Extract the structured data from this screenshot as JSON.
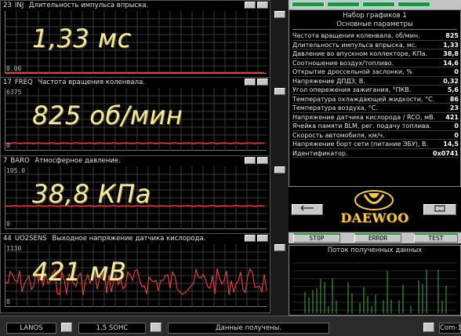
{
  "panels": [
    {
      "code": "23",
      "name": "INJ",
      "desc": "Длительность импульса впрыска.",
      "ymax": "",
      "ymin": "0.00",
      "big": "1,33 мс",
      "trace": "#e23b3b",
      "trace_level": 0.02
    },
    {
      "code": "17",
      "name": "FREQ",
      "desc": "Частота вращения коленвала.",
      "ymax": "6375",
      "ymin": "0",
      "big": "825 об/мин",
      "trace": "#e23b3b",
      "trace_level": 0.12
    },
    {
      "code": "7",
      "name": "BARO",
      "desc": "Атмосферное давление.",
      "ymax": "105.0",
      "ymin": "0",
      "big": "38,8 КПа",
      "trace": "#e23b3b",
      "trace_level": 0.37
    },
    {
      "code": "44",
      "name": "UO2SENS",
      "desc": "Выходное напряжение датчика кислорода.",
      "ymax": "1130",
      "ymin": "0",
      "big": "421 мВ",
      "trace": "#e23b3b",
      "trace_level": 0.4
    }
  ],
  "params": {
    "title": "Набор графиков 1",
    "subtitle": "Основные параметры",
    "rows": [
      {
        "label": "Частота вращения коленвала, об/мин.",
        "value": "825"
      },
      {
        "label": "Длительность импульса впрыска, мс.",
        "value": "1,33"
      },
      {
        "label": "Давление во впускном коллекторе, КПа.",
        "value": "38,8"
      },
      {
        "label": "Соотношение воздух/топливо.",
        "value": "14,6"
      },
      {
        "label": "Открытие дроссельной заслонки, %",
        "value": "0"
      },
      {
        "label": "Напряжение ДПДЗ, В.",
        "value": "0,32"
      },
      {
        "label": "Угол опережения зажигания, °ПКВ.",
        "value": "5,6"
      },
      {
        "label": "Температура охлаждающей жидкости, °С.",
        "value": "86"
      },
      {
        "label": "Температура воздуха, °С.",
        "value": "23"
      },
      {
        "label": "Напряжение датчика кислорода / RCO, мВ.",
        "value": "421"
      },
      {
        "label": "Ячейка памяти BLM, рег. подачу топлива.",
        "value": "0"
      },
      {
        "label": "Скорость автомобиля, км/ч.",
        "value": "0"
      },
      {
        "label": "Напряжение борт сети (питание ЭБУ), В.",
        "value": "14,5"
      },
      {
        "label": "Идентификатор.",
        "value": "0x0741"
      }
    ]
  },
  "logo": {
    "brand": "DAEWOO",
    "color": "#f2c74a"
  },
  "controls": {
    "stop": "STOP",
    "error": "ERROR",
    "test": "TEST"
  },
  "flow": {
    "title": "Поток полученных данных",
    "bar_color": "#3fae4a"
  },
  "status": {
    "model": "LANOS",
    "engine": "1.5 SOHC",
    "message": "Данные получены.",
    "port": "Com-1"
  }
}
